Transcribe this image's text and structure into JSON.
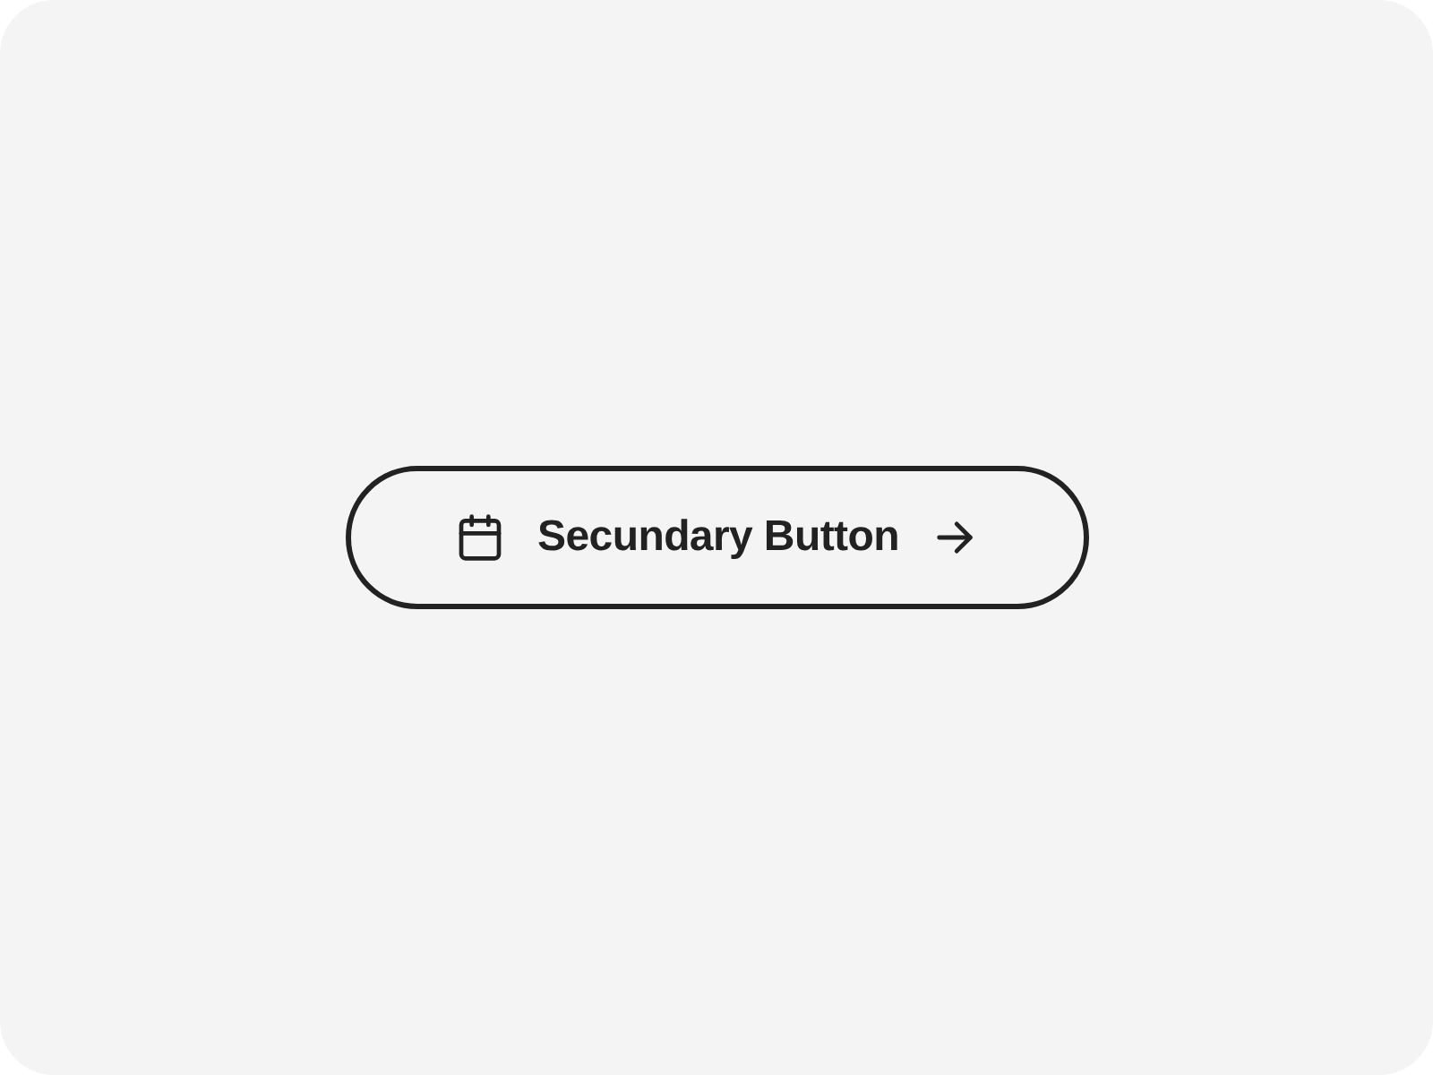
{
  "button": {
    "label": "Secundary Button"
  }
}
